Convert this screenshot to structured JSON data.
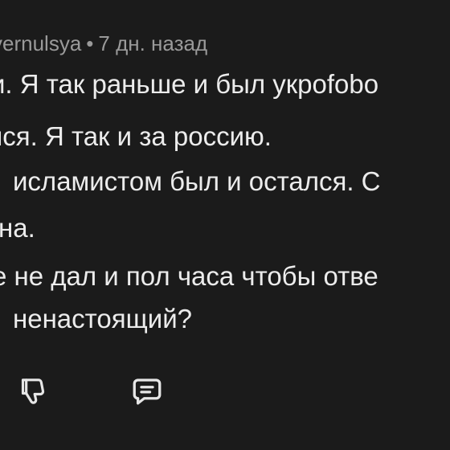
{
  "comment": {
    "author": "vernulsya",
    "separator": "•",
    "time_ago": "7 дн. назад",
    "lines": [
      "и. Я так раньше и был укpofobo",
      "лся. Я так и за россию.",
      "исламистом был и остался. С",
      "на.",
      "е не дал и пол часа чтобы отве",
      "ненастоящий?"
    ]
  },
  "actions": {
    "dislike_icon": "thumbs-down-icon",
    "reply_icon": "comment-icon"
  },
  "colors": {
    "background": "#1b1b1b",
    "text": "#ececec",
    "meta": "#9a9a9a",
    "icon": "#e6e6e6"
  }
}
